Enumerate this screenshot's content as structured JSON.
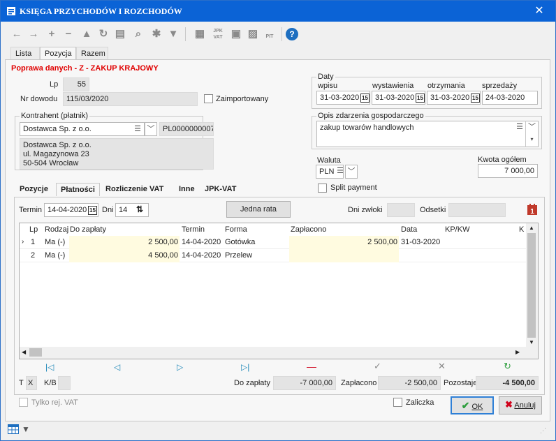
{
  "window": {
    "title": "KSIĘGA PRZYCHODÓW I ROZCHODÓW",
    "close_glyph": "✕"
  },
  "toolbar": {
    "icons": [
      "arrow-left-icon",
      "arrow-right-icon",
      "plus-icon",
      "minus-icon",
      "warning-triangle-icon",
      "refresh-icon",
      "print-icon",
      "search-icon",
      "settings-icon",
      "filter-icon",
      "report-icon",
      "jpk-vat-icon",
      "export-icon",
      "import-icon",
      "pit-icon",
      "help-icon"
    ],
    "jpk_text": "JPK\nVAT",
    "pit_text": "PIT"
  },
  "top_tabs": [
    "Lista",
    "Pozycja",
    "Razem"
  ],
  "form": {
    "heading": "Poprawa danych - Z - ZAKUP KRAJOWY",
    "lp_label": "Lp",
    "lp_value": "55",
    "nr_dowodu_label": "Nr dowodu",
    "nr_dowodu_value": "115/03/2020",
    "zaimportowany_label": "Zaimportowany",
    "kontrahent_label": "Kontrahent (płatnik)",
    "kontrahent_value": "Dostawca Sp. z o.o.",
    "nip_value": "PL0000000007",
    "address_lines": [
      "Dostawca Sp. z o.o.",
      "ul. Magazynowa 23",
      "50-504 Wrocław"
    ],
    "daty_label": "Daty",
    "dates": [
      {
        "label": "wpisu",
        "value": "31-03-2020"
      },
      {
        "label": "wystawienia",
        "value": "31-03-2020"
      },
      {
        "label": "otrzymania",
        "value": "31-03-2020"
      },
      {
        "label": "sprzedaży",
        "value": "24-03-2020"
      }
    ],
    "opis_label": "Opis zdarzenia gospodarczego",
    "opis_value": "zakup towarów handlowych",
    "waluta_label": "Waluta",
    "waluta_value": "PLN",
    "kwota_label": "Kwota ogółem",
    "kwota_value": "7 000,00",
    "split_label": "Split payment"
  },
  "inner_tabs": [
    "Pozycje",
    "Płatności",
    "Rozliczenie VAT",
    "Inne",
    "JPK-VAT"
  ],
  "payments": {
    "termin_label": "Termin",
    "termin_value": "14-04-2020",
    "dni_label": "Dni",
    "dni_value": "14",
    "jedna_rata_label": "Jedna rata",
    "dni_zwloki_label": "Dni zwłoki",
    "odsetki_label": "Odsetki",
    "columns": [
      "Lp",
      "Rodzaj",
      "Do zapłaty",
      "Termin",
      "Forma",
      "Zapłacono",
      "Data",
      "KP/KW",
      "K"
    ],
    "rows": [
      {
        "lp": "1",
        "rodzaj": "Ma (-)",
        "do_zaplaty": "2 500,00",
        "termin": "14-04-2020",
        "forma": "Gotówka",
        "zaplacono": "2 500,00",
        "data": "31-03-2020",
        "kpkw": ""
      },
      {
        "lp": "2",
        "rodzaj": "Ma (-)",
        "do_zaplaty": "4 500,00",
        "termin": "14-04-2020",
        "forma": "Przelew",
        "zaplacono": "",
        "data": "",
        "kpkw": ""
      }
    ],
    "t_label": "T",
    "t_value": "X",
    "kb_label": "K/B",
    "do_zaplaty_label": "Do zapłaty",
    "do_zaplaty_value": "-7 000,00",
    "zaplacono_label": "Zapłacono",
    "zaplacono_value": "-2 500,00",
    "pozostaje_label": "Pozostaje",
    "pozostaje_value": "-4 500,00"
  },
  "footer": {
    "tylko_label": "Tylko rej. VAT",
    "zaliczka_label": "Zaliczka",
    "ok_label": "OK",
    "anuluj_label": "Anuluj"
  },
  "colors": {
    "titlebar": "#0b63d6",
    "heading": "#e00000",
    "highlight": "#fffbe0",
    "ok_green": "#2e9e3e",
    "cancel_red": "#d0021b",
    "calendar_red": "#c0392b",
    "teal": "#1e88b8"
  }
}
